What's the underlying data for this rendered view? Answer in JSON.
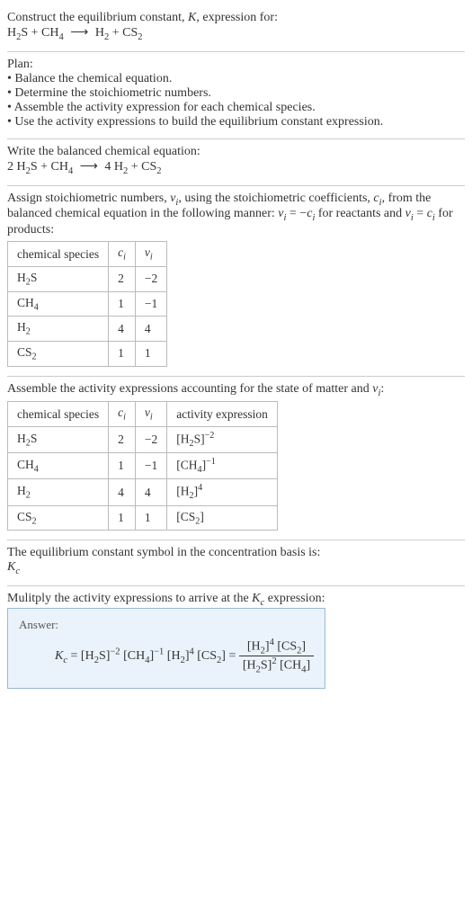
{
  "title": "Construct the equilibrium constant, K, expression for:",
  "equation_unbalanced": "H₂S + CH₄ ⟶ H₂ + CS₂",
  "plan_label": "Plan:",
  "plan": [
    "• Balance the chemical equation.",
    "• Determine the stoichiometric numbers.",
    "• Assemble the activity expression for each chemical species.",
    "• Use the activity expressions to build the equilibrium constant expression."
  ],
  "balanced_label": "Write the balanced chemical equation:",
  "equation_balanced": "2 H₂S + CH₄ ⟶ 4 H₂ + CS₂",
  "assign_text1": "Assign stoichiometric numbers, νᵢ, using the stoichiometric coefficients, cᵢ, from the balanced chemical equation in the following manner: νᵢ = −cᵢ for reactants and νᵢ = cᵢ for products:",
  "table1": {
    "headers": [
      "chemical species",
      "cᵢ",
      "νᵢ"
    ],
    "rows": [
      [
        "H₂S",
        "2",
        "−2"
      ],
      [
        "CH₄",
        "1",
        "−1"
      ],
      [
        "H₂",
        "4",
        "4"
      ],
      [
        "CS₂",
        "1",
        "1"
      ]
    ]
  },
  "activity_text": "Assemble the activity expressions accounting for the state of matter and νᵢ:",
  "table2": {
    "headers": [
      "chemical species",
      "cᵢ",
      "νᵢ",
      "activity expression"
    ],
    "rows": [
      {
        "sp": "H₂S",
        "c": "2",
        "v": "−2",
        "act_base": "[H₂S]",
        "act_exp": "−2"
      },
      {
        "sp": "CH₄",
        "c": "1",
        "v": "−1",
        "act_base": "[CH₄]",
        "act_exp": "−1"
      },
      {
        "sp": "H₂",
        "c": "4",
        "v": "4",
        "act_base": "[H₂]",
        "act_exp": "4"
      },
      {
        "sp": "CS₂",
        "c": "1",
        "v": "1",
        "act_base": "[CS₂]",
        "act_exp": ""
      }
    ]
  },
  "symbol_text": "The equilibrium constant symbol in the concentration basis is:",
  "symbol": "K𝒸",
  "multiply_text": "Mulitply the activity expressions to arrive at the K𝒸 expression:",
  "answer_label": "Answer:",
  "kc": {
    "lhs": "K𝒸 = [H₂S]⁻² [CH₄]⁻¹ [H₂]⁴ [CS₂] =",
    "num": "[H₂]⁴ [CS₂]",
    "den": "[H₂S]² [CH₄]"
  },
  "chart_data": {
    "type": "table",
    "tables": [
      {
        "headers": [
          "chemical species",
          "c_i",
          "nu_i"
        ],
        "rows": [
          [
            "H2S",
            2,
            -2
          ],
          [
            "CH4",
            1,
            -1
          ],
          [
            "H2",
            4,
            4
          ],
          [
            "CS2",
            1,
            1
          ]
        ]
      },
      {
        "headers": [
          "chemical species",
          "c_i",
          "nu_i",
          "activity expression"
        ],
        "rows": [
          [
            "H2S",
            2,
            -2,
            "[H2S]^-2"
          ],
          [
            "CH4",
            1,
            -1,
            "[CH4]^-1"
          ],
          [
            "H2",
            4,
            4,
            "[H2]^4"
          ],
          [
            "CS2",
            1,
            1,
            "[CS2]"
          ]
        ]
      }
    ]
  }
}
